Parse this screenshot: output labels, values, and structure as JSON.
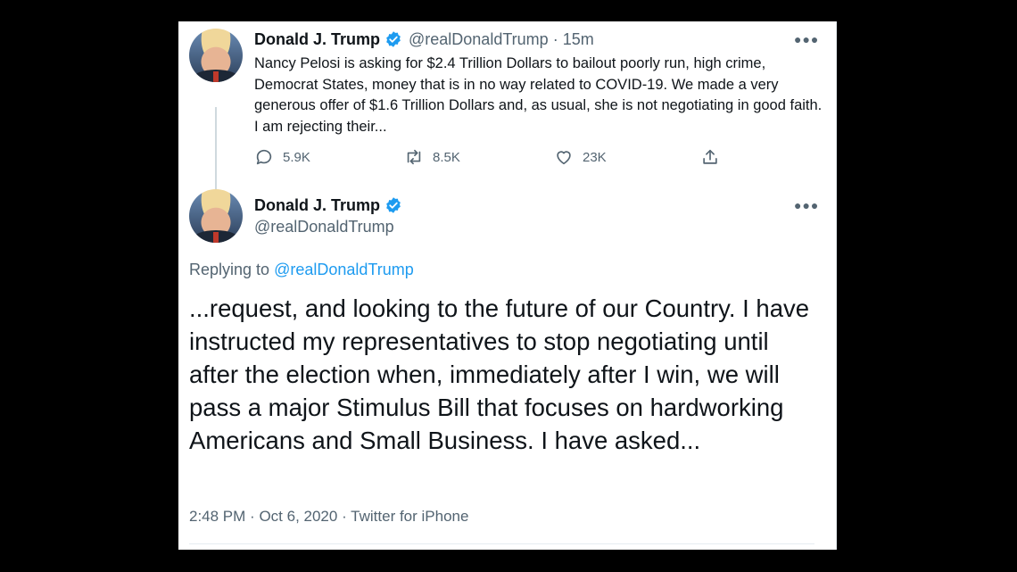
{
  "tweet1": {
    "author_name": "Donald J. Trump",
    "handle": "@realDonaldTrump",
    "separator": "·",
    "time": "15m",
    "text": "Nancy Pelosi is asking for $2.4 Trillion Dollars to bailout poorly run, high crime, Democrat States, money that is in no way related to COVID-19. We made a very generous offer of $1.6 Trillion Dollars and, as usual, she is not negotiating in good faith. I am rejecting their...",
    "replies": "5.9K",
    "retweets": "8.5K",
    "likes": "23K",
    "more_icon": "more-icon",
    "icons": [
      "reply-icon",
      "retweet-icon",
      "like-icon",
      "share-icon",
      "verified-icon"
    ]
  },
  "tweet2": {
    "author_name": "Donald J. Trump",
    "handle": "@realDonaldTrump",
    "replying_prefix": "Replying to",
    "replying_handle": "@realDonaldTrump",
    "text": "...request, and looking to the future of our Country. I have instructed my representatives to stop negotiating until after the election when, immediately after I win, we will pass a major Stimulus Bill that focuses on hardworking Americans and Small Business. I have asked...",
    "time": "2:48 PM",
    "date": "Oct 6, 2020",
    "source": "Twitter for iPhone",
    "separator": "·"
  },
  "colors": {
    "background": "#000000",
    "card": "#ffffff",
    "text": "#0f1419",
    "muted": "#536471",
    "link": "#1d9bf0",
    "verified": "#1d9bf0"
  }
}
